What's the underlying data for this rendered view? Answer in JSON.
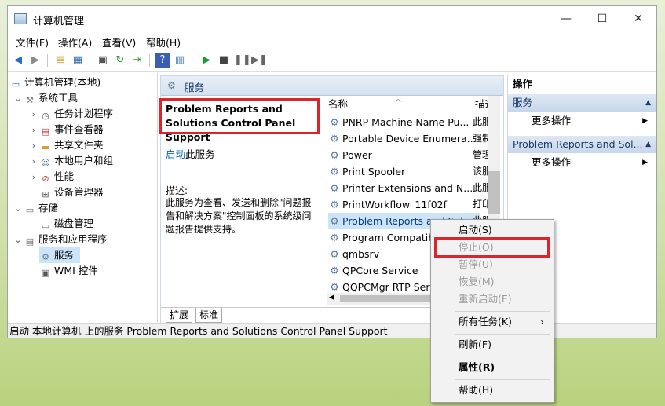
{
  "window": {
    "title": "计算机管理",
    "controls": {
      "minimize": "—",
      "maximize": "☐",
      "close": "✕"
    }
  },
  "menu": [
    "文件(F)",
    "操作(A)",
    "查看(V)",
    "帮助(H)"
  ],
  "tree": {
    "root": "计算机管理(本地)",
    "system_tools": "系统工具",
    "task_scheduler": "任务计划程序",
    "event_viewer": "事件查看器",
    "shared_folders": "共享文件夹",
    "local_users": "本地用户和组",
    "performance": "性能",
    "device_manager": "设备管理器",
    "storage": "存储",
    "disk_management": "磁盘管理",
    "services_apps": "服务和应用程序",
    "services": "服务",
    "wmi": "WMI 控件"
  },
  "center": {
    "header": "服务",
    "service_name": "Problem Reports and Solutions Control Panel Support",
    "start_link": "启动",
    "start_suffix": "此服务",
    "desc_label": "描述:",
    "desc_text": "此服务为查看、发送和删除\"问题报告和解决方案\"控制面板的系统级问题报告提供支持。",
    "col_name": "名称",
    "col_desc": "描述",
    "services": [
      {
        "name": "PNRP Machine Name Pu...",
        "desc": "此服"
      },
      {
        "name": "Portable Device Enumera...",
        "desc": "强制"
      },
      {
        "name": "Power",
        "desc": "管理"
      },
      {
        "name": "Print Spooler",
        "desc": "该服"
      },
      {
        "name": "Printer Extensions and N...",
        "desc": "此服"
      },
      {
        "name": "PrintWorkflow_11f02f",
        "desc": "打印"
      },
      {
        "name": "Problem Reports and Solu...",
        "desc": "此服"
      },
      {
        "name": "Program Compatibility A...",
        "desc": "此服"
      },
      {
        "name": "qmbsrv",
        "desc": ""
      },
      {
        "name": "QPCore Service",
        "desc": ""
      },
      {
        "name": "QQPCMgr RTP Service",
        "desc": ""
      }
    ],
    "tabs": [
      "扩展",
      "标准"
    ]
  },
  "actions": {
    "title": "操作",
    "section1": "服务",
    "more1": "更多操作",
    "section2": "Problem Reports and Sol...",
    "more2": "更多操作"
  },
  "status": "启动 本地计算机 上的服务 Problem Reports and Solutions Control Panel Support",
  "context_menu": {
    "start": "启动(S)",
    "stop": "停止(O)",
    "pause": "暂停(U)",
    "resume": "恢复(M)",
    "restart": "重新启动(E)",
    "all_tasks": "所有任务(K)",
    "refresh": "刷新(F)",
    "properties": "属性(R)",
    "help": "帮助(H)"
  },
  "colors": {
    "highlight": "#cce4f7",
    "red_annotation": "#d9262c",
    "link": "#0066cc"
  }
}
